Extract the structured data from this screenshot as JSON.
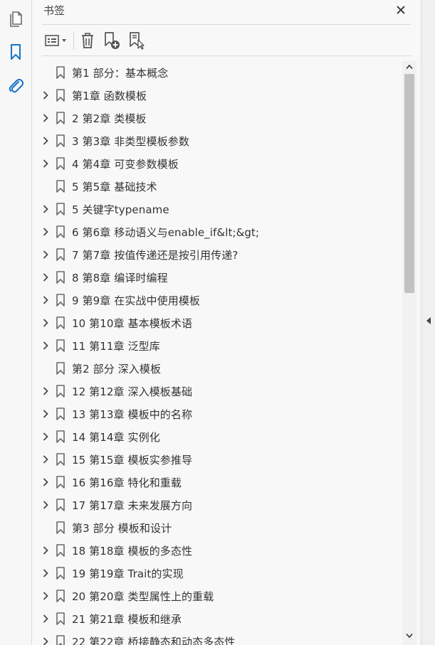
{
  "panel": {
    "title": "书签",
    "accent_color": "#1a73c8"
  },
  "left_rail": {
    "icons": [
      "page-thumbnails-icon",
      "bookmark-icon",
      "attachment-icon"
    ]
  },
  "toolbar": {
    "icons": [
      "options-menu-icon",
      "delete-icon",
      "new-bookmark-icon",
      "bookmark-from-selection-icon"
    ]
  },
  "bookmarks": [
    {
      "label": "第1 部分：基本概念",
      "expandable": false
    },
    {
      "label": "第1章 函数模板",
      "expandable": true
    },
    {
      "label": "2 第2章 类模板",
      "expandable": true
    },
    {
      "label": "3 第3章 非类型模板参数",
      "expandable": true
    },
    {
      "label": "4 第4章 可变参数模板",
      "expandable": true
    },
    {
      "label": "5 第5章 基础技术",
      "expandable": false
    },
    {
      "label": "5 关键字typename",
      "expandable": true
    },
    {
      "label": "6 第6章 移动语义与enable_if&lt;&gt;",
      "expandable": true
    },
    {
      "label": "7 第7章 按值传递还是按引用传递?",
      "expandable": true
    },
    {
      "label": "8 第8章 编译时编程",
      "expandable": true
    },
    {
      "label": "9 第9章 在实战中使用模板",
      "expandable": true
    },
    {
      "label": "10 第10章 基本模板术语",
      "expandable": true
    },
    {
      "label": "11 第11章 泛型库",
      "expandable": true
    },
    {
      "label": "第2 部分 深入模板",
      "expandable": false
    },
    {
      "label": "12 第12章 深入模板基础",
      "expandable": true
    },
    {
      "label": "13 第13章 模板中的名称",
      "expandable": true
    },
    {
      "label": "14 第14章 实例化",
      "expandable": true
    },
    {
      "label": "15 第15章 模板实参推导",
      "expandable": true
    },
    {
      "label": "16 第16章 特化和重载",
      "expandable": true
    },
    {
      "label": "17 第17章 未来发展方向",
      "expandable": true
    },
    {
      "label": "第3 部分 模板和设计",
      "expandable": false
    },
    {
      "label": "18 第18章 模板的多态性",
      "expandable": true
    },
    {
      "label": "19 第19章 Trait的实现",
      "expandable": true
    },
    {
      "label": "20 第20章 类型属性上的重载",
      "expandable": true
    },
    {
      "label": "21 第21章 模板和继承",
      "expandable": true
    },
    {
      "label": "22 第22章 桥接静态和动态多态性",
      "expandable": true
    }
  ]
}
